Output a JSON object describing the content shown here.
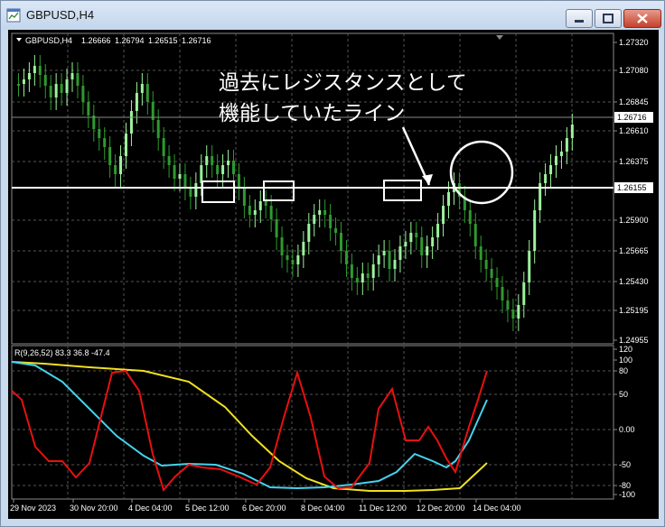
{
  "window": {
    "title": "GBPUSD,H4"
  },
  "price_chart": {
    "header": {
      "symbol": "GBPUSD,H4",
      "open": "1.26666",
      "high": "1.26794",
      "low": "1.26515",
      "close": "1.26716"
    },
    "y_ticks": [
      "1.27320",
      "1.27080",
      "1.26845",
      "1.26610",
      "1.26375",
      "1.25900",
      "1.25665",
      "1.25430",
      "1.25195",
      "1.24955"
    ],
    "current_price_label": "1.26716",
    "line_price_label": "1.26155",
    "annotation_line1": "過去にレジスタンスとして",
    "annotation_line2": "機能していたライン",
    "colors": {
      "bull": "#9cf29c",
      "bear": "#2e9a2e",
      "line": "#ffffff"
    }
  },
  "indicator": {
    "label": "R(9,26,52) 83.3 36.8 -47.4",
    "y_ticks": [
      "120",
      "100",
      "80",
      "50",
      "0.00",
      "-50",
      "-80",
      "-100"
    ],
    "series_colors": {
      "fast": "#e81010",
      "mid": "#46d2ee",
      "slow": "#f0e020"
    }
  },
  "time_axis": {
    "labels": [
      "29 Nov 2023",
      "30 Nov 20:00",
      "4 Dec 04:00",
      "5 Dec 12:00",
      "6 Dec 20:00",
      "8 Dec 04:00",
      "11 Dec 12:00",
      "12 Dec 20:00",
      "14 Dec 04:00"
    ]
  }
}
